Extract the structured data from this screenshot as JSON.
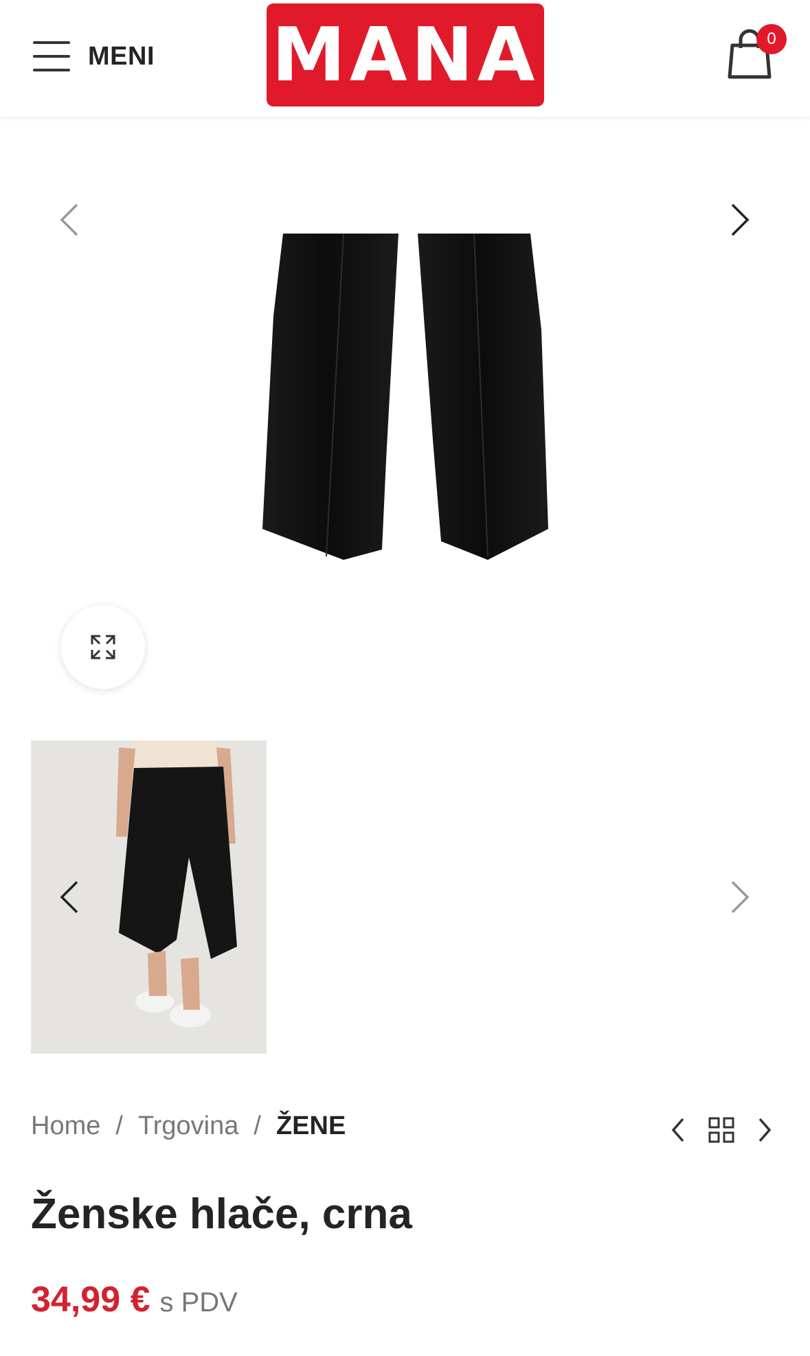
{
  "header": {
    "menu_label": "MENI",
    "logo_text": "MANA",
    "cart_count": "0"
  },
  "breadcrumb": {
    "items": [
      "Home",
      "Trgovina"
    ],
    "current": "ŽENE"
  },
  "product": {
    "title": "Ženske hlače, crna",
    "price": "34,99 €",
    "tax_note": "s PDV"
  },
  "colors": {
    "brand": "#e01a2b",
    "price": "#d3222f"
  },
  "icons": {
    "menu": "hamburger-icon",
    "cart": "shopping-bag-icon",
    "zoom": "expand-icon",
    "prev": "chevron-left-icon",
    "next": "chevron-right-icon",
    "grid": "grid-icon"
  }
}
